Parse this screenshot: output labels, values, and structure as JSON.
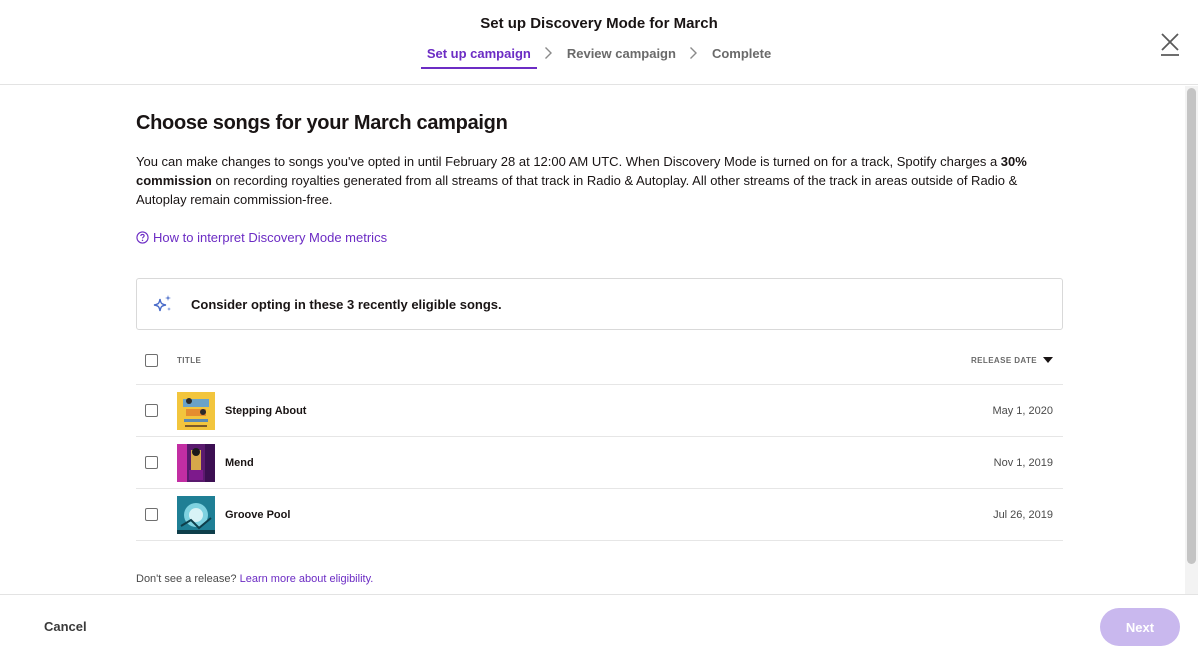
{
  "header": {
    "title": "Set up Discovery Mode for March",
    "steps": [
      {
        "label": "Set up campaign",
        "active": true
      },
      {
        "label": "Review campaign",
        "active": false
      },
      {
        "label": "Complete",
        "active": false
      }
    ]
  },
  "main": {
    "title": "Choose songs for your March campaign",
    "desc_part1": "You can make changes to songs you've opted in until February 28 at 12:00 AM UTC. When Discovery Mode is turned on for a track, Spotify charges a ",
    "desc_bold": "30% commission",
    "desc_part2": " on recording royalties generated from all streams of that track in Radio & Autoplay. All other streams of the track in areas outside of Radio & Autoplay remain commission-free.",
    "help_link": "How to interpret Discovery Mode metrics",
    "callout": "Consider opting in these 3 recently eligible songs.",
    "table": {
      "col_title": "TITLE",
      "col_date": "RELEASE DATE",
      "rows": [
        {
          "title": "Stepping About",
          "date": "May 1, 2020"
        },
        {
          "title": "Mend",
          "date": "Nov 1, 2019"
        },
        {
          "title": "Groove Pool",
          "date": "Jul 26, 2019"
        }
      ]
    },
    "footnote_text": "Don't see a release? ",
    "footnote_link": "Learn more about eligibility."
  },
  "footer": {
    "cancel": "Cancel",
    "next": "Next"
  },
  "colors": {
    "accent": "#6c2cc4",
    "next_disabled": "#c9b8ee"
  },
  "icons": {
    "close": "close-icon",
    "step_separator": "chevron-right-icon",
    "help": "question-circle-icon",
    "callout": "sparkle-icon",
    "sort": "caret-down-icon"
  }
}
